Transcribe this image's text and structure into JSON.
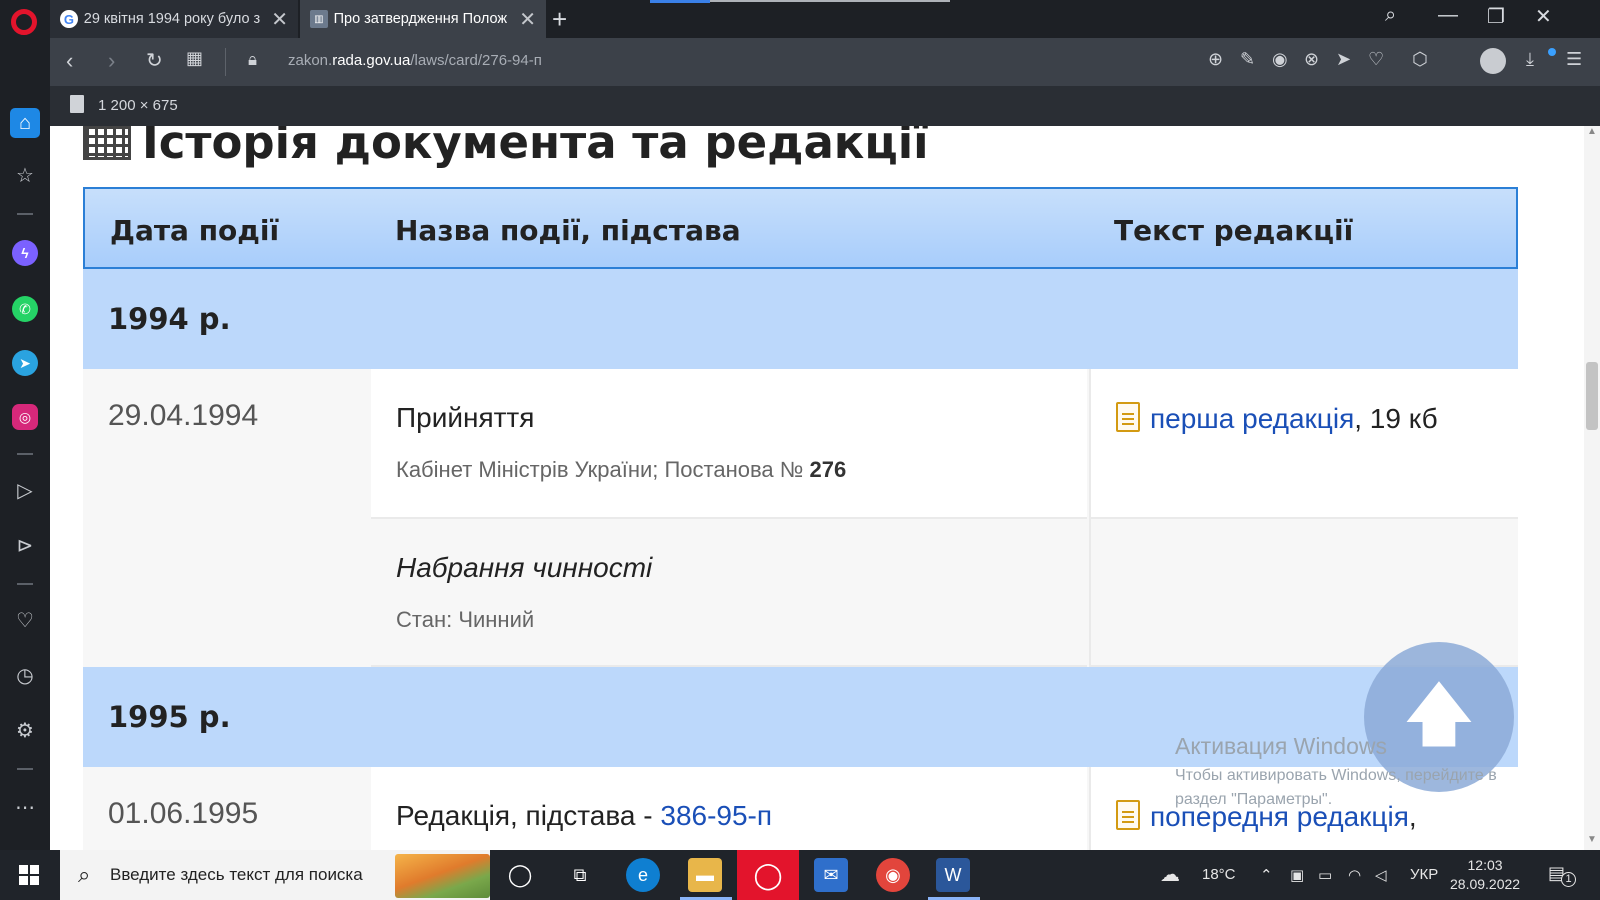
{
  "browser": {
    "tabs": [
      {
        "title": "29 квітня 1994 року було з",
        "favicon": "G"
      },
      {
        "title": "Про затвердження Полож",
        "favicon": "rada"
      }
    ],
    "url_prefix": "zakon.",
    "url_domain": "rada.gov.ua",
    "url_path": "/laws/card/276-94-п",
    "image_dims": "1 200 × 675"
  },
  "page": {
    "section_title": "Історія документа та редакції",
    "headers": {
      "date": "Дата події",
      "event": "Назва події, підстава",
      "edition": "Текст редакції"
    },
    "years": [
      {
        "label": "1994 р."
      },
      {
        "label": "1995 р."
      }
    ],
    "rows_1994": {
      "date": "29.04.1994",
      "event1_name": "Прийняття",
      "event1_sub_prefix": "Кабінет Міністрів України; Постанова №",
      "event1_sub_num": "276",
      "edition_link": "перша редакція",
      "edition_size": ", 19 кб",
      "event2_name": "Набрання чинності",
      "event2_sub": "Стан: Чинний"
    },
    "rows_1995": {
      "date": "01.06.1995",
      "event_name_prefix": "Редакція, підстава -",
      "event_link": "386-95-п",
      "edition_link": "попередня редакція",
      "edition_suffix": ","
    }
  },
  "overlay": {
    "activation_title": "Активация Windows",
    "activation_text_1": "Чтобы активировать Windows, перейдите в",
    "activation_text_2": "раздел \"Параметры\"."
  },
  "taskbar": {
    "search_placeholder": "Введите здесь текст для поиска",
    "temperature": "18°C",
    "language": "УКР",
    "time": "12:03",
    "date": "28.09.2022",
    "notifications": "1"
  },
  "colors": {
    "header_blue": "#a8cdfb",
    "year_row": "#bcd8fb",
    "link": "#1a4fb7",
    "opera_red": "#e3142c"
  }
}
